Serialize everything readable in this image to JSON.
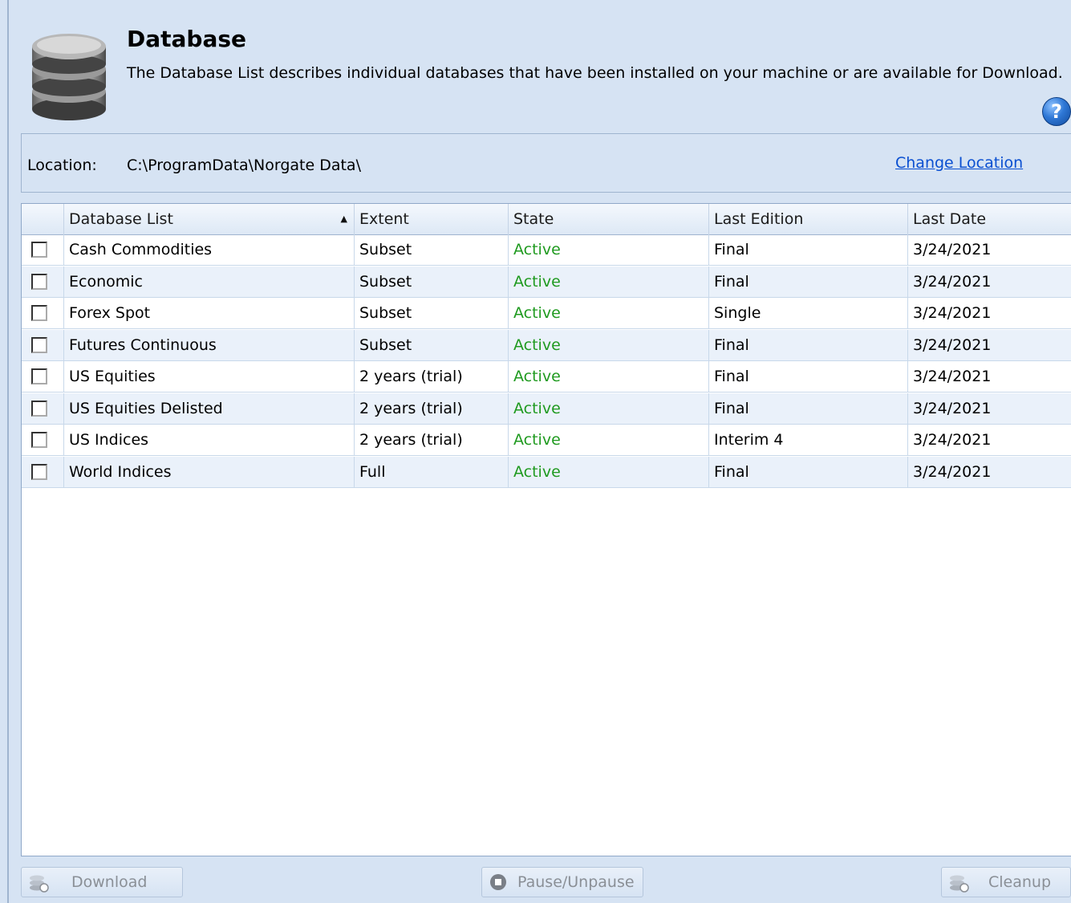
{
  "header": {
    "title": "Database",
    "description": "The Database List describes individual databases that have been installed on your machine or are available for Download.",
    "icon": "database-stack-icon",
    "help_icon": "help-icon",
    "help_glyph": "?"
  },
  "location": {
    "label": "Location:",
    "value": "C:\\ProgramData\\Norgate Data\\",
    "change_link": "Change Location"
  },
  "grid": {
    "columns": [
      "Database List",
      "Extent",
      "State",
      "Last Edition",
      "Last Date"
    ],
    "sort_column": "Database List",
    "sort_direction": "ascending",
    "sort_glyph": "▲",
    "rows": [
      {
        "name": "Cash Commodities",
        "extent": "Subset",
        "state": "Active",
        "edition": "Final",
        "date": "3/24/2021",
        "checked": false
      },
      {
        "name": "Economic",
        "extent": "Subset",
        "state": "Active",
        "edition": "Final",
        "date": "3/24/2021",
        "checked": false
      },
      {
        "name": "Forex Spot",
        "extent": "Subset",
        "state": "Active",
        "edition": "Single",
        "date": "3/24/2021",
        "checked": false
      },
      {
        "name": "Futures Continuous",
        "extent": "Subset",
        "state": "Active",
        "edition": "Final",
        "date": "3/24/2021",
        "checked": false
      },
      {
        "name": "US Equities",
        "extent": "2 years (trial)",
        "state": "Active",
        "edition": "Final",
        "date": "3/24/2021",
        "checked": false
      },
      {
        "name": "US Equities Delisted",
        "extent": "2 years (trial)",
        "state": "Active",
        "edition": "Final",
        "date": "3/24/2021",
        "checked": false
      },
      {
        "name": "US Indices",
        "extent": "2 years (trial)",
        "state": "Active",
        "edition": "Interim 4",
        "date": "3/24/2021",
        "checked": false
      },
      {
        "name": "World Indices",
        "extent": "Full",
        "state": "Active",
        "edition": "Final",
        "date": "3/24/2021",
        "checked": false
      }
    ]
  },
  "buttons": {
    "download": "Download",
    "pause": "Pause/Unpause",
    "cleanup": "Cleanup"
  },
  "colors": {
    "background": "#d6e3f3",
    "state_active": "#1f9a1f",
    "link": "#0a4fd1",
    "alt_row": "#eaf1fa"
  }
}
